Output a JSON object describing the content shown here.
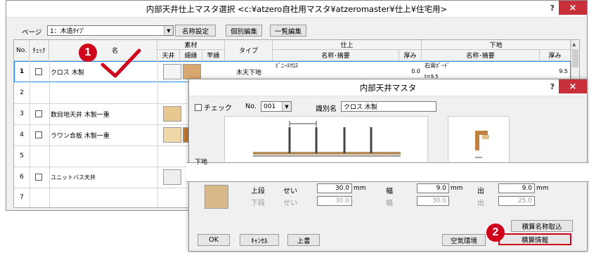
{
  "main_window": {
    "title": "内部天井仕上マスタ選択 <c:¥atzero自社用マスタ¥atzeromaster¥仕上¥住宅用>",
    "help": "?",
    "close": "×",
    "page_label": "ページ",
    "page_value": "1：木造ﾀｲﾌﾟ",
    "btn_name_settings": "名称設定",
    "btn_individual_edit": "個別編集",
    "btn_bulk_edit": "一覧編集",
    "headers": {
      "no": "No.",
      "check": "ﾁｪｯｸ",
      "name_partial": "名",
      "material": "素材",
      "ceiling": "天井",
      "fine": "細縁",
      "saobuchi": "竿縁",
      "type": "タイプ",
      "finish": "仕上",
      "finish_name": "名称･摘要",
      "finish_thick": "厚み",
      "base": "下地",
      "base_name": "名称･摘要",
      "base_thick": "厚み"
    },
    "rows": [
      {
        "no": "1",
        "name": "クロス 木製",
        "type": "木天下地",
        "finish_name": "ﾋﾞﾆｰﾙｸﾛｽ",
        "finish_thick": "0.0",
        "base_name": "石膏ﾎﾞｰﾄﾞ",
        "base_sub": "t=9.5",
        "base_thick": "9.5"
      },
      {
        "no": "2",
        "name": ""
      },
      {
        "no": "3",
        "name": "数目地天井 木製一重"
      },
      {
        "no": "4",
        "name": "ラワン合板 木製一重"
      },
      {
        "no": "5",
        "name": ""
      },
      {
        "no": "6",
        "name": "ユニットバス天井"
      },
      {
        "no": "7",
        "name": ""
      }
    ]
  },
  "sub_window": {
    "title": "内部天井マスタ",
    "help": "?",
    "close": "×",
    "check_label": "チェック",
    "no_label": "No.",
    "no_value": "001",
    "id_label": "識別名",
    "id_value": "クロス 木製",
    "section_partial": "下地",
    "upper_label": "上段",
    "lower_label": "下段",
    "height_label": "せい",
    "width_label": "幅",
    "out_label": "出",
    "upper_height": "30.0",
    "upper_width": "9.0",
    "upper_out": "9.0",
    "lower_height": "30.0",
    "lower_width": "30.0",
    "lower_out": "25.0",
    "unit": "mm",
    "btn_ok": "OK",
    "btn_cancel": "ｷｬﾝｾﾙ",
    "btn_overwrite": "上書",
    "btn_air": "空気環境",
    "btn_estimate_name": "積算名称取込",
    "btn_estimate_info": "積算情報"
  },
  "annotations": {
    "badge1": "1",
    "badge2": "2"
  },
  "colors": {
    "accent_red": "#d0021b",
    "selection_blue": "#1e90ff"
  }
}
